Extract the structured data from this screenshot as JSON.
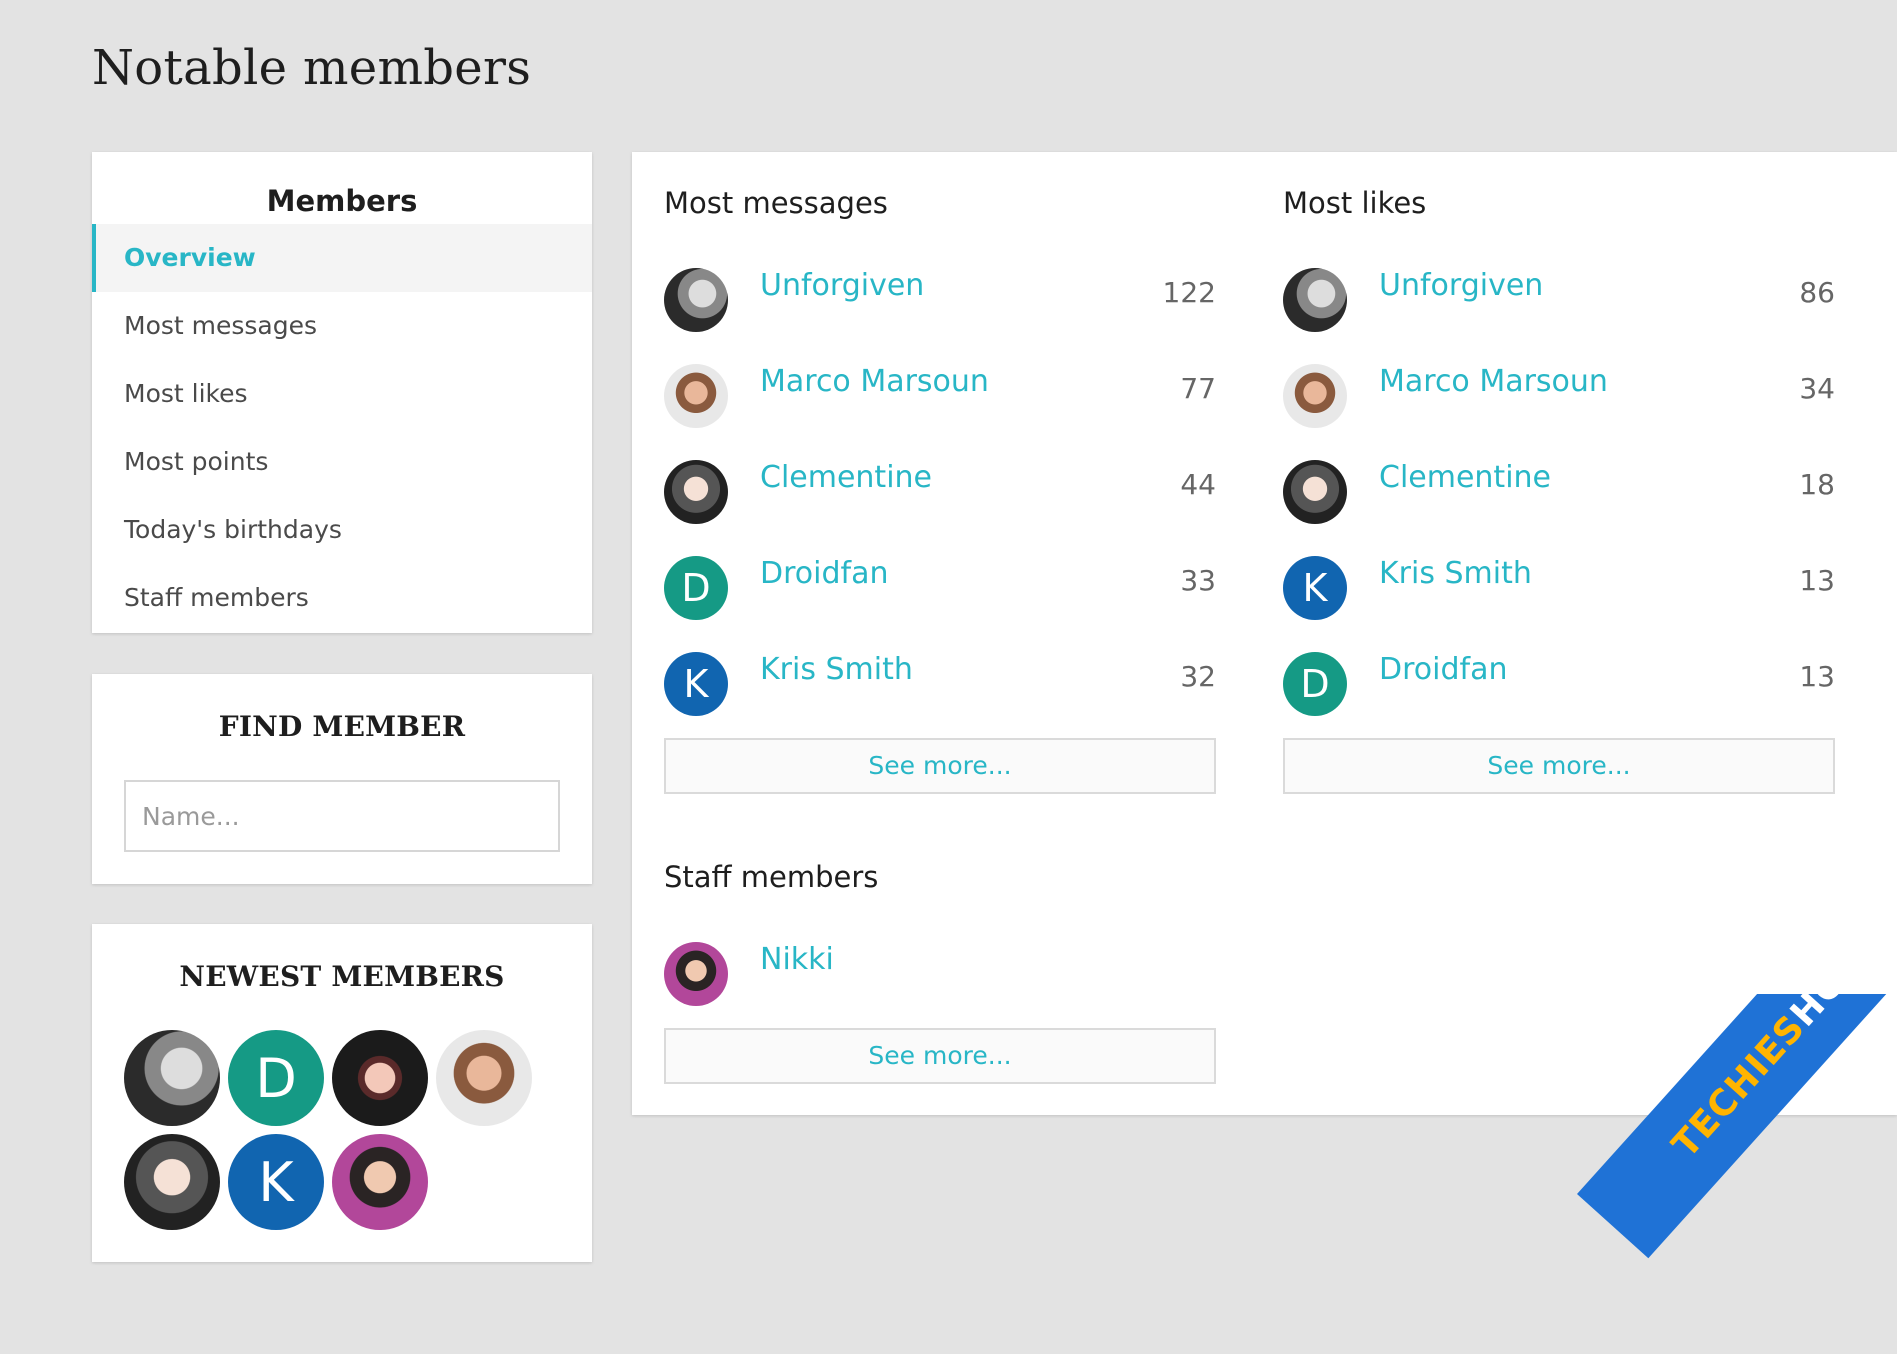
{
  "page": {
    "title": "Notable members"
  },
  "nav": {
    "title": "Members",
    "items": [
      {
        "label": "Overview",
        "active": true
      },
      {
        "label": "Most messages",
        "active": false
      },
      {
        "label": "Most likes",
        "active": false
      },
      {
        "label": "Most points",
        "active": false
      },
      {
        "label": "Today's birthdays",
        "active": false
      },
      {
        "label": "Staff members",
        "active": false
      }
    ]
  },
  "find_member": {
    "title": "FIND MEMBER",
    "placeholder": "Name..."
  },
  "newest_members": {
    "title": "NEWEST MEMBERS",
    "avatars": [
      {
        "name": "Unforgiven",
        "style": "gray",
        "letter": ""
      },
      {
        "name": "Droidfan",
        "style": "teal",
        "letter": "D"
      },
      {
        "name": "goth-girl",
        "style": "goth",
        "letter": ""
      },
      {
        "name": "Marco Marsoun",
        "style": "man",
        "letter": ""
      },
      {
        "name": "Clementine",
        "style": "face",
        "letter": ""
      },
      {
        "name": "Kris Smith",
        "style": "blue",
        "letter": "K"
      },
      {
        "name": "Nikki",
        "style": "nikki",
        "letter": ""
      }
    ]
  },
  "most_messages": {
    "title": "Most messages",
    "members": [
      {
        "name": "Unforgiven",
        "count": "122",
        "avatar": "gray",
        "letter": ""
      },
      {
        "name": "Marco Marsoun",
        "count": "77",
        "avatar": "man",
        "letter": ""
      },
      {
        "name": "Clementine",
        "count": "44",
        "avatar": "face",
        "letter": ""
      },
      {
        "name": "Droidfan",
        "count": "33",
        "avatar": "teal",
        "letter": "D"
      },
      {
        "name": "Kris Smith",
        "count": "32",
        "avatar": "blue",
        "letter": "K"
      }
    ],
    "see_more": "See more..."
  },
  "most_likes": {
    "title": "Most likes",
    "members": [
      {
        "name": "Unforgiven",
        "count": "86",
        "avatar": "gray",
        "letter": ""
      },
      {
        "name": "Marco Marsoun",
        "count": "34",
        "avatar": "man",
        "letter": ""
      },
      {
        "name": "Clementine",
        "count": "18",
        "avatar": "face",
        "letter": ""
      },
      {
        "name": "Kris Smith",
        "count": "13",
        "avatar": "blue",
        "letter": "K"
      },
      {
        "name": "Droidfan",
        "count": "13",
        "avatar": "teal",
        "letter": "D"
      }
    ],
    "see_more": "See more..."
  },
  "staff_members": {
    "title": "Staff members",
    "members": [
      {
        "name": "Nikki",
        "count": "",
        "avatar": "nikki",
        "letter": ""
      }
    ],
    "see_more": "See more..."
  },
  "colors": {
    "accent": "#28b6c6",
    "teal_avatar": "#159a85",
    "blue_avatar": "#1165b0",
    "watermark_blue": "#1f72d6",
    "watermark_highlight": "#ffb400"
  },
  "watermark": {
    "prefix": "TECHIES",
    "suffix": "HOME.COM"
  }
}
